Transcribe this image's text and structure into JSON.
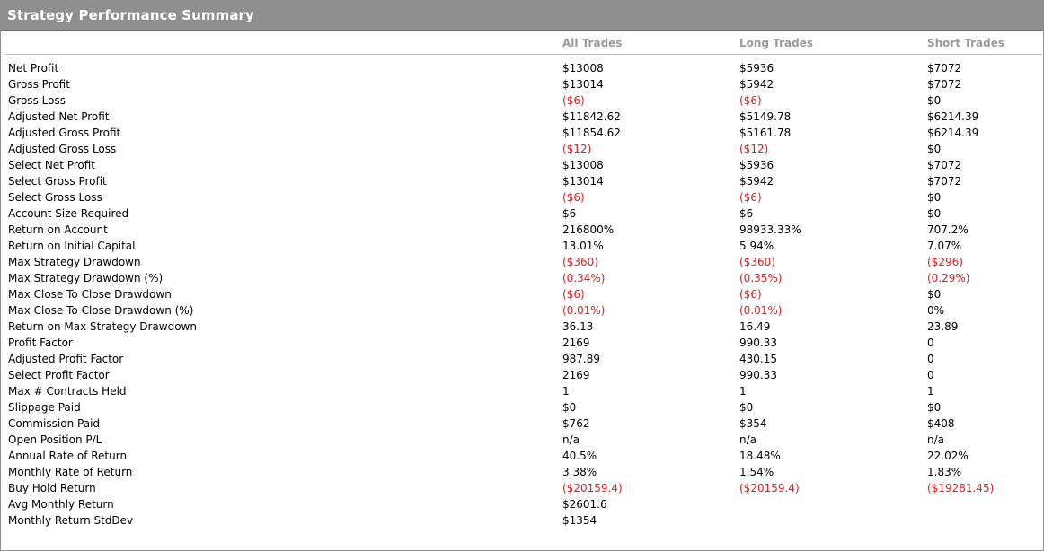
{
  "title": "Strategy Performance Summary",
  "columns": {
    "all": "All Trades",
    "long": "Long Trades",
    "short": "Short Trades"
  },
  "colors": {
    "header_bg": "#8f8f8f",
    "header_text": "#ffffff",
    "negative": "#e21a1a",
    "column_header": "#9a9a9a"
  },
  "rows": [
    {
      "label": "Net Profit",
      "all": "$13008",
      "long": "$5936",
      "short": "$7072"
    },
    {
      "label": "Gross Profit",
      "all": "$13014",
      "long": "$5942",
      "short": "$7072"
    },
    {
      "label": "Gross Loss",
      "all": "($6)",
      "long": "($6)",
      "short": "$0"
    },
    {
      "label": "Adjusted Net Profit",
      "all": "$11842.62",
      "long": "$5149.78",
      "short": "$6214.39"
    },
    {
      "label": "Adjusted Gross Profit",
      "all": "$11854.62",
      "long": "$5161.78",
      "short": "$6214.39"
    },
    {
      "label": "Adjusted Gross Loss",
      "all": "($12)",
      "long": "($12)",
      "short": "$0"
    },
    {
      "label": "Select Net Profit",
      "all": "$13008",
      "long": "$5936",
      "short": "$7072"
    },
    {
      "label": "Select Gross Profit",
      "all": "$13014",
      "long": "$5942",
      "short": "$7072"
    },
    {
      "label": "Select Gross Loss",
      "all": "($6)",
      "long": "($6)",
      "short": "$0"
    },
    {
      "label": "Account Size Required",
      "all": "$6",
      "long": "$6",
      "short": "$0"
    },
    {
      "label": "Return on Account",
      "all": "216800%",
      "long": "98933.33%",
      "short": "707.2%"
    },
    {
      "label": "Return on Initial Capital",
      "all": "13.01%",
      "long": "5.94%",
      "short": "7.07%"
    },
    {
      "label": "Max Strategy Drawdown",
      "all": "($360)",
      "long": "($360)",
      "short": "($296)"
    },
    {
      "label": "Max Strategy Drawdown (%)",
      "all": "(0.34%)",
      "long": "(0.35%)",
      "short": "(0.29%)"
    },
    {
      "label": "Max Close To Close Drawdown",
      "all": "($6)",
      "long": "($6)",
      "short": "$0"
    },
    {
      "label": "Max Close To Close Drawdown (%)",
      "all": "(0.01%)",
      "long": "(0.01%)",
      "short": "0%"
    },
    {
      "label": "Return on Max Strategy Drawdown",
      "all": "36.13",
      "long": "16.49",
      "short": "23.89"
    },
    {
      "label": "Profit Factor",
      "all": "2169",
      "long": "990.33",
      "short": "0"
    },
    {
      "label": "Adjusted Profit Factor",
      "all": "987.89",
      "long": "430.15",
      "short": "0"
    },
    {
      "label": "Select Profit Factor",
      "all": "2169",
      "long": "990.33",
      "short": "0"
    },
    {
      "label": "Max # Contracts Held",
      "all": "1",
      "long": "1",
      "short": "1"
    },
    {
      "label": "Slippage Paid",
      "all": "$0",
      "long": "$0",
      "short": "$0"
    },
    {
      "label": "Commission Paid",
      "all": "$762",
      "long": "$354",
      "short": "$408"
    },
    {
      "label": "Open Position P/L",
      "all": "n/a",
      "long": "n/a",
      "short": "n/a"
    },
    {
      "label": "Annual Rate of Return",
      "all": "40.5%",
      "long": "18.48%",
      "short": "22.02%"
    },
    {
      "label": "Monthly Rate of Return",
      "all": "3.38%",
      "long": "1.54%",
      "short": "1.83%"
    },
    {
      "label": "Buy  Hold Return",
      "all": "($20159.4)",
      "long": "($20159.4)",
      "short": "($19281.45)"
    },
    {
      "label": "Avg Monthly Return",
      "all": "$2601.6",
      "long": "",
      "short": ""
    },
    {
      "label": "Monthly Return StdDev",
      "all": "$1354",
      "long": "",
      "short": ""
    }
  ]
}
